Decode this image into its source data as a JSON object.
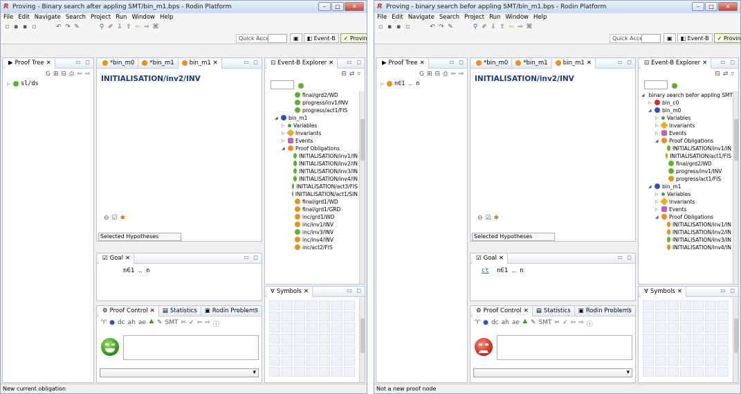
{
  "windows": [
    {
      "title": "Proving - Binary search after appling SMT/bin_m1.bps - Rodin Platform",
      "menu": [
        "File",
        "Edit",
        "Navigate",
        "Search",
        "Project",
        "Run",
        "Window",
        "Help"
      ],
      "quick_access": "Quick Access",
      "perspectives": [
        "Event-B",
        "Proving"
      ],
      "proof_tree": {
        "tab": "Proof Tree",
        "node": "sl/ds",
        "toolbar_g": "G"
      },
      "editor_tabs": [
        "*bin_m0",
        "*bin_m1",
        "bin_m1"
      ],
      "editor_title": "INITIALISATION/inv2/INV",
      "selected_hypotheses": "Selected Hypotheses",
      "goal": {
        "tab": "Goal",
        "text": "n∈1 ‥ n",
        "prefix": ""
      },
      "proof_control_tabs": [
        "Proof Control",
        "Statistics",
        "Rodin Problems"
      ],
      "explorer": {
        "tab": "Event-B Explorer",
        "items": [
          {
            "label": "final/grd2/WD",
            "icon": "c",
            "indent": 3
          },
          {
            "label": "progress/inv1/INV",
            "icon": "c",
            "indent": 3
          },
          {
            "label": "progress/act1/FIS",
            "icon": "c",
            "indent": 3
          },
          {
            "label": "bin_m1",
            "icon": "b",
            "indent": 1,
            "tw": "◢"
          },
          {
            "label": "Variables",
            "icon": "g",
            "indent": 2,
            "tw": "▷"
          },
          {
            "label": "Invariants",
            "icon": "y",
            "indent": 2,
            "tw": "▷"
          },
          {
            "label": "Events",
            "icon": "p",
            "indent": 2,
            "tw": "▷"
          },
          {
            "label": "Proof Obligations",
            "icon": "o",
            "indent": 2,
            "tw": "◢"
          },
          {
            "label": "INITIALISATION/inv1/IN",
            "icon": "c",
            "indent": 3
          },
          {
            "label": "INITIALISATION/inv2/IN",
            "icon": "c",
            "indent": 3
          },
          {
            "label": "INITIALISATION/inv3/IN",
            "icon": "c",
            "indent": 3
          },
          {
            "label": "INITIALISATION/inv4/IN",
            "icon": "c",
            "indent": 3
          },
          {
            "label": "INITIALISATION/act3/FIS",
            "icon": "c",
            "indent": 3
          },
          {
            "label": "INITIALISATION/act1/SIN",
            "icon": "c",
            "indent": 3
          },
          {
            "label": "final/grd1/WD",
            "icon": "o",
            "indent": 3
          },
          {
            "label": "final/grd1/GRD",
            "icon": "o",
            "indent": 3
          },
          {
            "label": "inc/grd1/WD",
            "icon": "o",
            "indent": 3
          },
          {
            "label": "inc/inv1/INV",
            "icon": "o",
            "indent": 3
          },
          {
            "label": "inc/inv3/INV",
            "icon": "c",
            "indent": 3
          },
          {
            "label": "inc/inv4/INV",
            "icon": "o",
            "indent": 3
          },
          {
            "label": "inc/act2/FIS",
            "icon": "o",
            "indent": 3
          }
        ]
      },
      "symbols_tab": "Symbols",
      "status": "New current obligation",
      "face": "green"
    },
    {
      "title": "Proving - binary search befor appling SMT/bin_m1.bps - Rodin Platform",
      "menu": [
        "File",
        "Edit",
        "Navigate",
        "Search",
        "Project",
        "Run",
        "Window",
        "Help"
      ],
      "quick_access": "Quick Access",
      "perspectives": [
        "Event-B",
        "Proving"
      ],
      "proof_tree": {
        "tab": "Proof Tree",
        "node": "n∈1 ‥ n",
        "toolbar_g": "G"
      },
      "editor_tabs": [
        "*bin_m0",
        "*bin_m1",
        "bin_m1"
      ],
      "editor_title": "INITIALISATION/inv2/INV",
      "selected_hypotheses": "Selected Hypotheses",
      "goal": {
        "tab": "Goal",
        "text": "n∈1 ‥ n",
        "prefix": "ct"
      },
      "proof_control_tabs": [
        "Proof Control",
        "Statistics",
        "Rodin Problems"
      ],
      "explorer": {
        "tab": "Event-B Explorer",
        "items": [
          {
            "label": "binary search befor appling SMT",
            "icon": "tr",
            "indent": 0,
            "tw": "◢"
          },
          {
            "label": "bin_c0",
            "icon": "r",
            "indent": 1,
            "tw": "▷"
          },
          {
            "label": "bin_m0",
            "icon": "b",
            "indent": 1,
            "tw": "◢"
          },
          {
            "label": "Variables",
            "icon": "g",
            "indent": 2,
            "tw": "▷"
          },
          {
            "label": "Invariants",
            "icon": "y",
            "indent": 2,
            "tw": "▷"
          },
          {
            "label": "Events",
            "icon": "p",
            "indent": 2,
            "tw": "▷"
          },
          {
            "label": "Proof Obligations",
            "icon": "o",
            "indent": 2,
            "tw": "◢"
          },
          {
            "label": "INITIALISATION/inv1/IN",
            "icon": "c",
            "indent": 3
          },
          {
            "label": "INITIALISATION/act1/FIS",
            "icon": "o",
            "indent": 3
          },
          {
            "label": "final/grd2/WD",
            "icon": "c",
            "indent": 3
          },
          {
            "label": "progress/inv1/INV",
            "icon": "c",
            "indent": 3
          },
          {
            "label": "progress/act1/FIS",
            "icon": "o",
            "indent": 3
          },
          {
            "label": "bin_m1",
            "icon": "b",
            "indent": 1,
            "tw": "◢"
          },
          {
            "label": "Variables",
            "icon": "g",
            "indent": 2,
            "tw": "▷"
          },
          {
            "label": "Invariants",
            "icon": "y",
            "indent": 2,
            "tw": "▷"
          },
          {
            "label": "Events",
            "icon": "p",
            "indent": 2,
            "tw": "▷"
          },
          {
            "label": "Proof Obligations",
            "icon": "o",
            "indent": 2,
            "tw": "◢"
          },
          {
            "label": "INITIALISATION/inv1/IN",
            "icon": "o",
            "indent": 3
          },
          {
            "label": "INITIALISATION/inv2/IN",
            "icon": "o",
            "indent": 3
          },
          {
            "label": "INITIALISATION/inv3/IN",
            "icon": "c",
            "indent": 3
          },
          {
            "label": "INITIALISATION/inv4/IN",
            "icon": "o",
            "indent": 3
          }
        ]
      },
      "symbols_tab": "Symbols",
      "status": "Not a new proof node",
      "face": "red"
    }
  ]
}
